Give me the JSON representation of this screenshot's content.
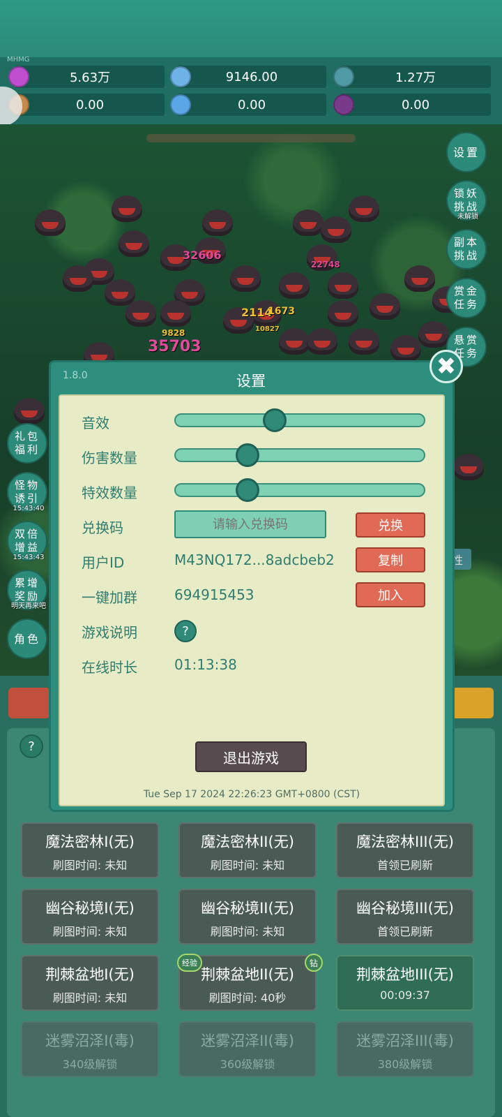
{
  "resources": {
    "gem": "5.63万",
    "crystal": "9146.00",
    "ore": "1.27万",
    "item4": "0.00",
    "item5": "0.00",
    "item6": "0.00"
  },
  "mini_label": "MHMG",
  "damage_numbers": [
    "32606",
    "22748",
    "2114",
    "1673",
    "35703",
    "9828",
    "10827"
  ],
  "side_buttons_right": [
    {
      "label": "设置"
    },
    {
      "label": "锁妖挑战",
      "sub": "未解锁"
    },
    {
      "label": "副本挑战"
    },
    {
      "label": "赏金任务"
    },
    {
      "label": "悬赏任务"
    }
  ],
  "side_buttons_left": [
    {
      "label": "礼包福利"
    },
    {
      "label": "怪物诱引",
      "sub": "15:43:40"
    },
    {
      "label": "双倍增益",
      "sub": "15:43:43"
    },
    {
      "label": "累增奖励",
      "sub": "明天再来吧"
    },
    {
      "label": "角色"
    }
  ],
  "side_tag": "性",
  "settings": {
    "version": "1.8.0",
    "title": "设置",
    "close": "✖",
    "sound_label": "音效",
    "sound_level": 0.4,
    "damage_label": "伤害数量",
    "damage_level": 0.29,
    "effects_label": "特效数量",
    "effects_level": 0.29,
    "redeem_label": "兑换码",
    "redeem_placeholder": "请输入兑换码",
    "redeem_button": "兑换",
    "userid_label": "用户ID",
    "userid_value": "M43NQ172...8adcbeb2",
    "copy_button": "复制",
    "group_label": "一键加群",
    "group_value": "694915453",
    "join_button": "加入",
    "guide_label": "游戏说明",
    "guide_icon": "?",
    "online_label": "在线时长",
    "online_value": "01:13:38",
    "quit_button": "退出游戏",
    "timestamp": "Tue Sep 17 2024 22:26:23 GMT+0800 (CST)"
  },
  "help_icon": "?",
  "maps": [
    {
      "name": "魔法密林I(无)",
      "info": "刷图时间: 未知",
      "state": "normal"
    },
    {
      "name": "魔法密林II(无)",
      "info": "刷图时间: 未知",
      "state": "normal"
    },
    {
      "name": "魔法密林III(无)",
      "info": "首领已刷新",
      "state": "normal"
    },
    {
      "name": "幽谷秘境I(无)",
      "info": "刷图时间: 未知",
      "state": "normal"
    },
    {
      "name": "幽谷秘境II(无)",
      "info": "刷图时间: 未知",
      "state": "normal"
    },
    {
      "name": "幽谷秘境III(无)",
      "info": "首领已刷新",
      "state": "normal"
    },
    {
      "name": "荆棘盆地I(无)",
      "info": "刷图时间: 未知",
      "state": "normal"
    },
    {
      "name": "荆棘盆地II(无)",
      "info": "刷图时间: 40秒",
      "state": "normal"
    },
    {
      "name": "荆棘盆地III(无)",
      "info": "00:09:37",
      "state": "active"
    },
    {
      "name": "迷雾沼泽I(毒)",
      "info": "340级解锁",
      "state": "locked"
    },
    {
      "name": "迷雾沼泽II(毒)",
      "info": "360级解锁",
      "state": "locked"
    },
    {
      "name": "迷雾沼泽III(毒)",
      "info": "380级解锁",
      "state": "locked"
    }
  ],
  "map_badges": {
    "exp": "经验",
    "diamond": "钻"
  }
}
